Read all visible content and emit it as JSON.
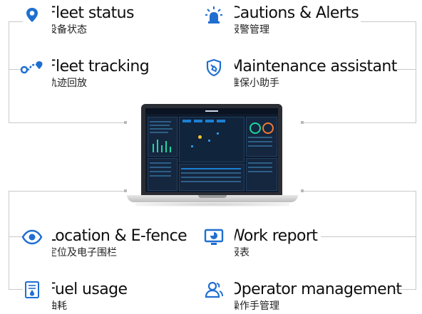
{
  "features": [
    {
      "id": "fleet-status",
      "title": "Fleet status",
      "subtitle": "设备状态",
      "icon": "location-pin-icon"
    },
    {
      "id": "cautions-alerts",
      "title": "Cautions & Alerts",
      "subtitle": "报警管理",
      "icon": "alarm-light-icon"
    },
    {
      "id": "fleet-tracking",
      "title": "Fleet tracking",
      "subtitle": "轨迹回放",
      "icon": "route-icon"
    },
    {
      "id": "maintenance-assistant",
      "title": "Maintenance assistant",
      "subtitle": "维保小助手",
      "icon": "wrench-shield-icon"
    },
    {
      "id": "location-efence",
      "title": "Location & E-fence",
      "subtitle": "定位及电子围栏",
      "icon": "eye-icon"
    },
    {
      "id": "work-report",
      "title": "Work report",
      "subtitle": "报表",
      "icon": "monitor-chart-icon"
    },
    {
      "id": "fuel-usage",
      "title": "Fuel usage",
      "subtitle": "油耗",
      "icon": "fuel-doc-icon"
    },
    {
      "id": "operator-management",
      "title": "Operator management",
      "subtitle": "操作手管理",
      "icon": "users-icon"
    }
  ],
  "colors": {
    "icon_blue": "#1f6fd1",
    "line_gray": "#c9c9c9",
    "screen_bg": "#0f1a2c"
  }
}
